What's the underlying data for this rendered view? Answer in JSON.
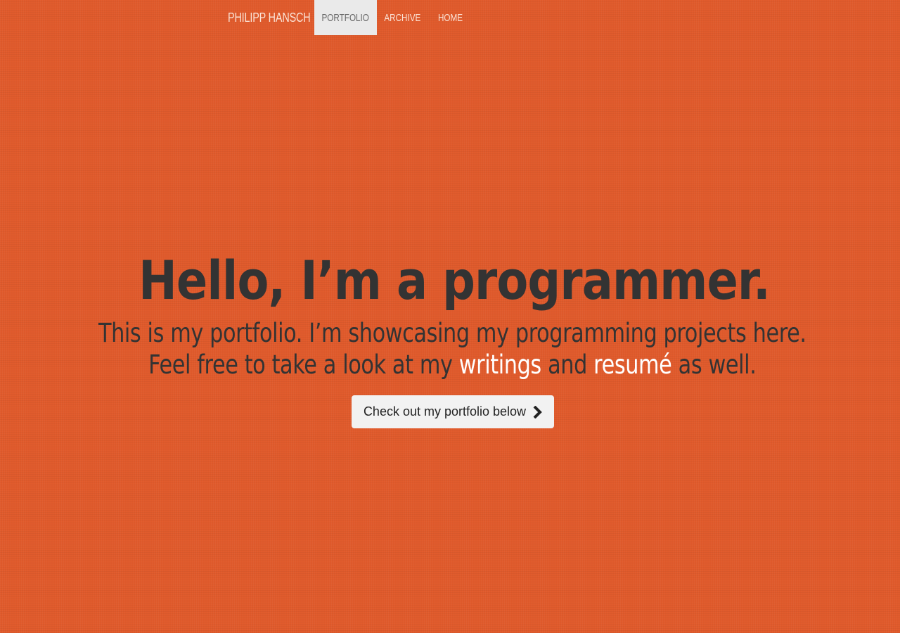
{
  "navbar": {
    "brand": "PHILIPP HANSCH",
    "items": [
      {
        "label": "PORTFOLIO",
        "active": true
      },
      {
        "label": "ARCHIVE",
        "active": false
      },
      {
        "label": "HOME",
        "active": false
      }
    ]
  },
  "hero": {
    "title": "Hello, I’m a programmer.",
    "line1": "This is my portfolio. I’m showcasing my programming projects here.",
    "line2_prefix": "Feel free to take a look at my ",
    "link_writings": "writings",
    "line2_and": " and ",
    "link_resume": "resumé",
    "line2_suffix": " as well.",
    "cta_label": "Check out my portfolio below",
    "cta_icon": "chevron-right-icon"
  },
  "colors": {
    "background": "#e05a2b",
    "text": "#333333",
    "link": "#ffffff",
    "nav_active_bg": "#eaeaea"
  }
}
